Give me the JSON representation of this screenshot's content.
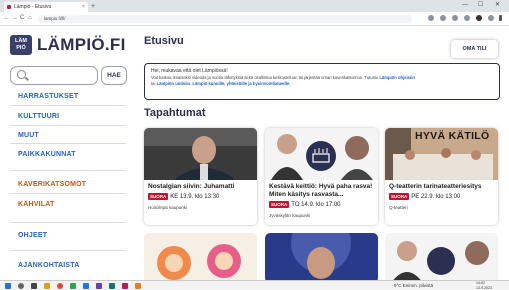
{
  "browser": {
    "tab_title": "Lämpiö - Etusivu",
    "tab_close": "×",
    "new_tab": "+",
    "win_min": "—",
    "win_max": "☐",
    "win_close": "✕",
    "address": "lampio.fi/fi/",
    "nav_back": "←",
    "nav_forward": "→",
    "nav_reload": "C",
    "nav_home": "⌂"
  },
  "sidebar": {
    "logo_line1": "LÄM",
    "logo_line2": "PIÖ",
    "logo_text": "LÄMPIÖ.FI",
    "search_button": "HAE",
    "items": [
      {
        "label": "HARRASTUKSET",
        "color": "#2561c9"
      },
      {
        "label": "KULTTUURI",
        "color": "#2561c9"
      },
      {
        "label": "MUUT",
        "color": "#2561c9"
      },
      {
        "label": "PAIKKAKUNNAT",
        "color": "#2561c9"
      },
      {
        "label": "KAVERIKATSOMOT",
        "color": "#c2571a"
      },
      {
        "label": "KAHVILAT",
        "color": "#c2571a"
      },
      {
        "label": "OHJEET",
        "color": "#2561c9"
      },
      {
        "label": "AJANKOHTAISTA",
        "color": "#2561c9"
      }
    ]
  },
  "main": {
    "title": "Etusivu",
    "account_button": "OMA TILI",
    "notice_line1": "Hei, mukavaa että olet Lämpiössä!",
    "notice_line2a": "Voit katsoa ilmaiseksi videoita ja suoria lähetyksiä sekä osallistua keskusteluun tai järjestää oman kaverikatsomon. Tutustu ",
    "notice_link1": "Lämpiön ohjeisiin",
    "notice_line3a": "tai ",
    "notice_link2": "Lämpiön uutisiin",
    "notice_line3b": ". ",
    "notice_link3": "Lämpiö kunnille, yhteisöille ja hyvinvointialueille.",
    "events_title": "Tapahtumat",
    "badge_text": "SUORA",
    "events": [
      {
        "title": "Nostalgian siivin: Juhamatti",
        "date": "KE 13.9. klo 13:30",
        "place": "Hoitolinjat kaupunki"
      },
      {
        "title": "Kestävä keittiö: Hyvä paha rasva! Miten käsitys rasvasta...",
        "date": "TO 14.9. klo 17:00",
        "place": "Jyväskylän kaupunki"
      },
      {
        "title": "Q-teatterin tarinateatteriesitys",
        "date": "PE 22.9. klo 13:00",
        "place": "Q-teatteri",
        "image_text": "HYVÄ KÄTILÖ"
      }
    ]
  },
  "taskbar": {
    "weather": "9°C Enimm. pilvistä",
    "time": "14:02",
    "date": "13.9.2023"
  }
}
